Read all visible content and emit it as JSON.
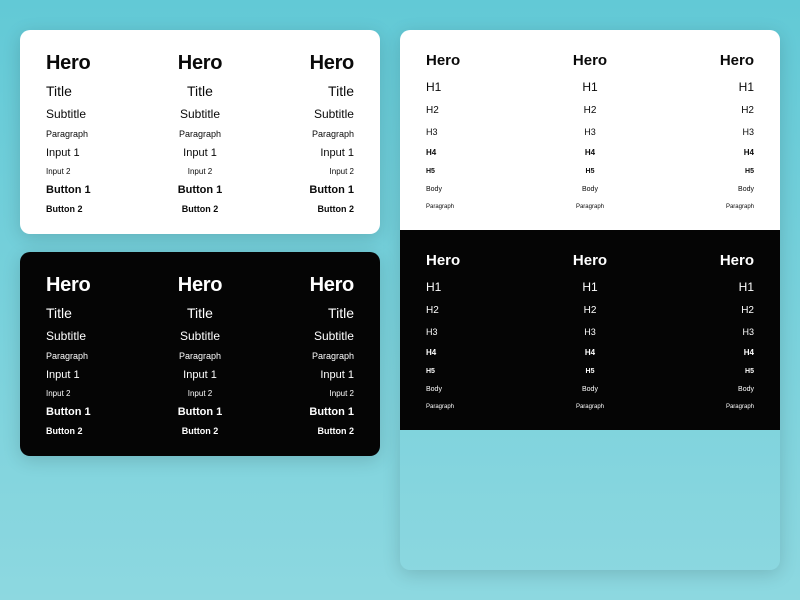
{
  "left_card": {
    "items": [
      "Hero",
      "Title",
      "Subtitle",
      "Paragraph",
      "Input 1",
      "Input 2",
      "Button 1",
      "Button 2"
    ]
  },
  "right_panel": {
    "items": [
      "Hero",
      "H1",
      "H2",
      "H3",
      "H4",
      "H5",
      "Body",
      "Paragraph"
    ]
  }
}
